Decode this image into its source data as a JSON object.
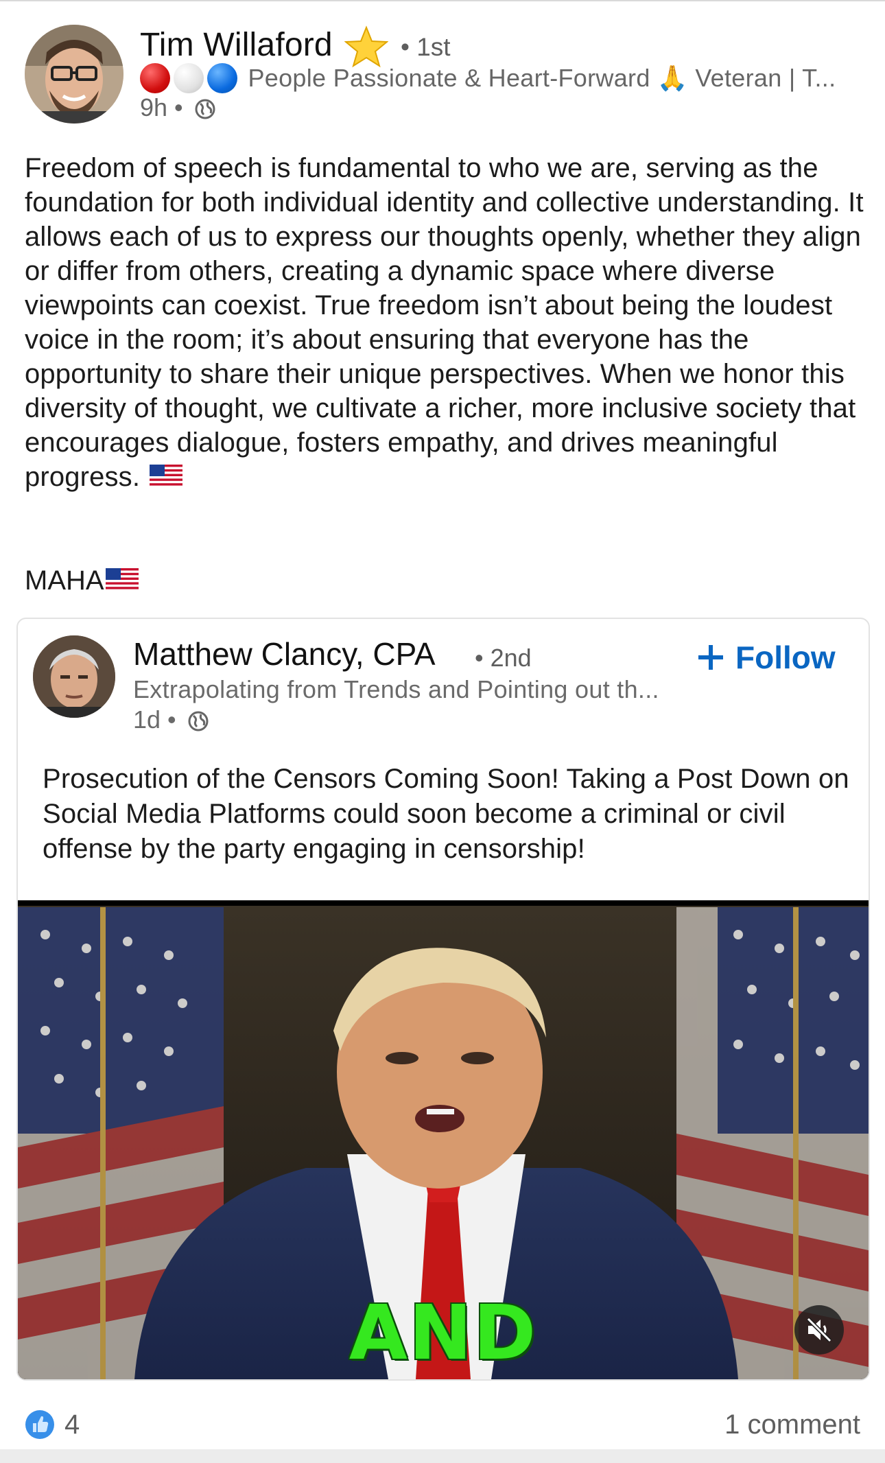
{
  "post": {
    "author_name": "Tim Willaford",
    "author_badge_icon": "star-icon",
    "degree": "• 1st",
    "headline": "People Passionate & Heart-Forward 🙏 Veteran | T...",
    "headline_icons": [
      "red-circle-icon",
      "white-circle-icon",
      "blue-circle-icon"
    ],
    "time": "9h •",
    "visibility_icon": "globe-icon",
    "body": "Freedom of speech is fundamental to who we are, serving as the foundation for both individual identity and collective understanding. It allows each of us to express our thoughts openly, whether they align or differ from others, creating a dynamic space where diverse viewpoints can coexist. True freedom isn’t about being the loudest voice in the room; it’s about ensuring that everyone has the opportunity to share their unique perspectives. When we honor this diversity of thought, we cultivate a richer, more inclusive society that encourages dialogue, fosters empathy, and drives meaningful progress.",
    "body_trailing_icon": "us-flag-icon",
    "tagline": "MAHA"
  },
  "reshare": {
    "author_name": "Matthew Clancy, CPA",
    "degree": "• 2nd",
    "follow_label": "Follow",
    "headline": "Extrapolating from Trends and Pointing out th...",
    "time": "1d •",
    "text": "Prosecution of the Censors Coming Soon!  Taking a Post Down on Social Media Platforms could soon become a criminal or civil offense by the party engaging in censorship!",
    "video_caption": "AND",
    "video_muted": true
  },
  "footer": {
    "reaction_icon": "like-icon",
    "reaction_count": "4",
    "comments": "1 comment"
  },
  "colors": {
    "link_blue": "#0a66c2",
    "caption_green": "#35e81f"
  }
}
